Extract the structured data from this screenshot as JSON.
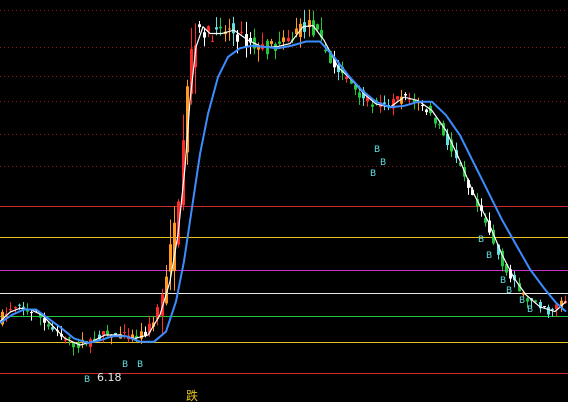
{
  "chart_data": {
    "type": "candlestick",
    "ylim": [
      6.0,
      12.0
    ],
    "low_label": "6.18",
    "signal_label": "跌",
    "signal_marker": "B",
    "reference_lines": [
      {
        "y": 11.85,
        "color": "#8b1a1a",
        "style": "dotted"
      },
      {
        "y": 11.3,
        "color": "#8b1a1a",
        "style": "dotted"
      },
      {
        "y": 10.86,
        "color": "#8b1a1a",
        "style": "dotted"
      },
      {
        "y": 10.5,
        "color": "#8b1a1a",
        "style": "dotted"
      },
      {
        "y": 10.0,
        "color": "#8b1a1a",
        "style": "dotted"
      },
      {
        "y": 9.52,
        "color": "#8b1a1a",
        "style": "dotted"
      },
      {
        "y": 8.92,
        "color": "#cc2a2a",
        "style": "solid"
      },
      {
        "y": 8.47,
        "color": "#e6c21c",
        "style": "solid"
      },
      {
        "y": 7.97,
        "color": "#cc33cc",
        "style": "solid"
      },
      {
        "y": 7.63,
        "color": "#e8e8e8",
        "style": "solid"
      },
      {
        "y": 7.28,
        "color": "#22c83c",
        "style": "solid"
      },
      {
        "y": 6.9,
        "color": "#e6c21c",
        "style": "solid"
      },
      {
        "y": 6.43,
        "color": "#cc2a2a",
        "style": "solid"
      }
    ],
    "series": [
      {
        "type": "line",
        "color": "#ffffff",
        "points": [
          [
            0,
            7.2
          ],
          [
            10,
            7.34
          ],
          [
            20,
            7.4
          ],
          [
            30,
            7.38
          ],
          [
            42,
            7.3
          ],
          [
            55,
            7.1
          ],
          [
            65,
            6.95
          ],
          [
            80,
            6.85
          ],
          [
            92,
            6.9
          ],
          [
            105,
            7.0
          ],
          [
            120,
            7.0
          ],
          [
            135,
            6.95
          ],
          [
            148,
            7.0
          ],
          [
            160,
            7.3
          ],
          [
            170,
            7.8
          ],
          [
            178,
            8.5
          ],
          [
            185,
            9.5
          ],
          [
            190,
            10.5
          ],
          [
            196,
            11.3
          ],
          [
            203,
            11.6
          ],
          [
            210,
            11.5
          ],
          [
            222,
            11.5
          ],
          [
            234,
            11.55
          ],
          [
            248,
            11.4
          ],
          [
            262,
            11.3
          ],
          [
            276,
            11.3
          ],
          [
            290,
            11.35
          ],
          [
            303,
            11.6
          ],
          [
            313,
            11.62
          ],
          [
            324,
            11.4
          ],
          [
            338,
            11.0
          ],
          [
            352,
            10.8
          ],
          [
            364,
            10.6
          ],
          [
            376,
            10.45
          ],
          [
            390,
            10.4
          ],
          [
            404,
            10.55
          ],
          [
            418,
            10.5
          ],
          [
            432,
            10.35
          ],
          [
            446,
            10.05
          ],
          [
            460,
            9.6
          ],
          [
            474,
            9.1
          ],
          [
            488,
            8.7
          ],
          [
            502,
            8.2
          ],
          [
            514,
            7.85
          ],
          [
            526,
            7.6
          ],
          [
            540,
            7.42
          ],
          [
            555,
            7.35
          ],
          [
            566,
            7.5
          ]
        ]
      },
      {
        "type": "line",
        "color": "#3d8cff",
        "points": [
          [
            0,
            7.18
          ],
          [
            12,
            7.3
          ],
          [
            24,
            7.38
          ],
          [
            36,
            7.38
          ],
          [
            48,
            7.25
          ],
          [
            60,
            7.12
          ],
          [
            74,
            6.95
          ],
          [
            88,
            6.88
          ],
          [
            100,
            6.92
          ],
          [
            112,
            6.98
          ],
          [
            126,
            6.98
          ],
          [
            140,
            6.9
          ],
          [
            154,
            6.9
          ],
          [
            166,
            7.05
          ],
          [
            176,
            7.5
          ],
          [
            184,
            8.1
          ],
          [
            192,
            8.9
          ],
          [
            200,
            9.7
          ],
          [
            208,
            10.3
          ],
          [
            218,
            10.85
          ],
          [
            228,
            11.15
          ],
          [
            240,
            11.28
          ],
          [
            252,
            11.32
          ],
          [
            264,
            11.3
          ],
          [
            278,
            11.28
          ],
          [
            292,
            11.32
          ],
          [
            306,
            11.38
          ],
          [
            320,
            11.38
          ],
          [
            334,
            11.15
          ],
          [
            348,
            10.88
          ],
          [
            362,
            10.65
          ],
          [
            376,
            10.48
          ],
          [
            390,
            10.4
          ],
          [
            404,
            10.42
          ],
          [
            418,
            10.48
          ],
          [
            432,
            10.48
          ],
          [
            446,
            10.28
          ],
          [
            460,
            9.98
          ],
          [
            474,
            9.56
          ],
          [
            488,
            9.14
          ],
          [
            502,
            8.72
          ],
          [
            516,
            8.35
          ],
          [
            530,
            7.98
          ],
          [
            544,
            7.7
          ],
          [
            556,
            7.48
          ],
          [
            566,
            7.35
          ]
        ]
      }
    ],
    "bars_generated": "procedural candlesticks tracking the price path"
  }
}
